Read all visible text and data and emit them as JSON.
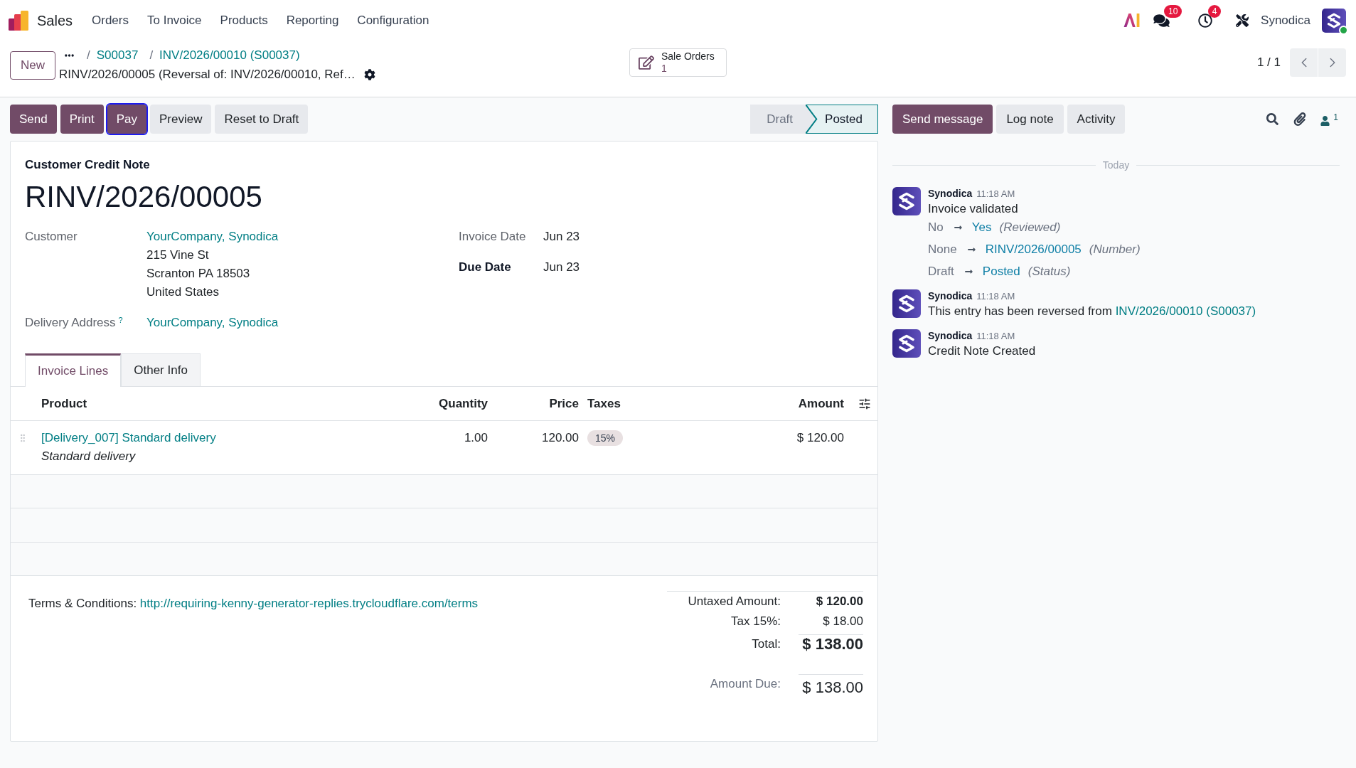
{
  "navbar": {
    "app_name": "Sales",
    "menu": [
      "Orders",
      "To Invoice",
      "Products",
      "Reporting",
      "Configuration"
    ],
    "messages_badge": "10",
    "activities_badge": "4",
    "user_name": "Synodica",
    "user_online": true
  },
  "control_panel": {
    "new_button": "New",
    "breadcrumbs": [
      {
        "separator": "/",
        "label": "S00037"
      },
      {
        "separator": "/",
        "label": "INV/2026/00010 (S00037)"
      }
    ],
    "current_record": "RINV/2026/00005 (Reversal of: INV/2026/00010, Ref…",
    "smart_button": {
      "label": "Sale Orders",
      "count": "1"
    },
    "pager": "1 / 1"
  },
  "actions": [
    {
      "label": "Send",
      "kind": "primary",
      "focused": false
    },
    {
      "label": "Print",
      "kind": "primary",
      "focused": false
    },
    {
      "label": "Pay",
      "kind": "primary",
      "focused": true
    },
    {
      "label": "Preview",
      "kind": "secondary",
      "focused": false
    },
    {
      "label": "Reset to Draft",
      "kind": "secondary",
      "focused": false
    }
  ],
  "status_bar": [
    {
      "label": "Draft",
      "selected": false
    },
    {
      "label": "Posted",
      "selected": true
    }
  ],
  "form": {
    "type_label": "Customer Credit Note",
    "number": "RINV/2026/00005",
    "left_fields": [
      {
        "label": "Customer",
        "value": "YourCompany, Synodica",
        "address": [
          "215 Vine St",
          "Scranton PA 18503",
          "United States"
        ]
      },
      {
        "label": "Delivery Address",
        "help_mark": "?",
        "value": "YourCompany, Synodica"
      }
    ],
    "right_fields": [
      {
        "label": "Invoice Date",
        "value": "Jun 23",
        "kind": "field"
      },
      {
        "label": "Due Date",
        "value": "Jun 23",
        "kind": "group-label"
      }
    ]
  },
  "tabs": [
    {
      "label": "Invoice Lines",
      "selected": true
    },
    {
      "label": "Other Info",
      "selected": false
    }
  ],
  "invoice_lines": {
    "columns": [
      "Product",
      "Quantity",
      "Price",
      "Taxes",
      "Amount"
    ],
    "rows": [
      {
        "product": "[Delivery_007] Standard delivery",
        "description": "Standard delivery",
        "quantity": "1.00",
        "price": "120.00",
        "taxes": [
          "15%"
        ],
        "amount": "$ 120.00"
      }
    ]
  },
  "terms": {
    "text": "Terms & Conditions:",
    "link": "http://requiring-kenny-generator-replies.trycloudflare.com/terms"
  },
  "totals": [
    {
      "label": "Untaxed Amount:",
      "value": "$ 120.00",
      "kind": "subtotal"
    },
    {
      "label": "Tax 15%:",
      "value": "$ 18.00",
      "kind": "tax"
    },
    {
      "label": "Total:",
      "value": "$ 138.00",
      "kind": "total"
    }
  ],
  "amount_due": {
    "label": "Amount Due:",
    "value": "$ 138.00"
  },
  "chatter": {
    "buttons": [
      {
        "label": "Send message",
        "kind": "primary"
      },
      {
        "label": "Log note",
        "kind": "secondary"
      },
      {
        "label": "Activity",
        "kind": "secondary"
      }
    ],
    "followers_count": "1",
    "date_separator": "Today",
    "messages": [
      {
        "author": "Synodica",
        "time": "11:18 AM",
        "body": "Invoice validated",
        "tracking": [
          {
            "old": "No",
            "new": "Yes",
            "field": "(Reviewed)"
          },
          {
            "old": "None",
            "new": "RINV/2026/00005",
            "field": "(Number)"
          },
          {
            "old": "Draft",
            "new": "Posted",
            "field": "(Status)"
          }
        ]
      },
      {
        "author": "Synodica",
        "time": "11:18 AM",
        "body": "This entry has been reversed from",
        "link": "INV/2026/00010 (S00037)"
      },
      {
        "author": "Synodica",
        "time": "11:18 AM",
        "body": "Credit Note Created"
      }
    ]
  }
}
